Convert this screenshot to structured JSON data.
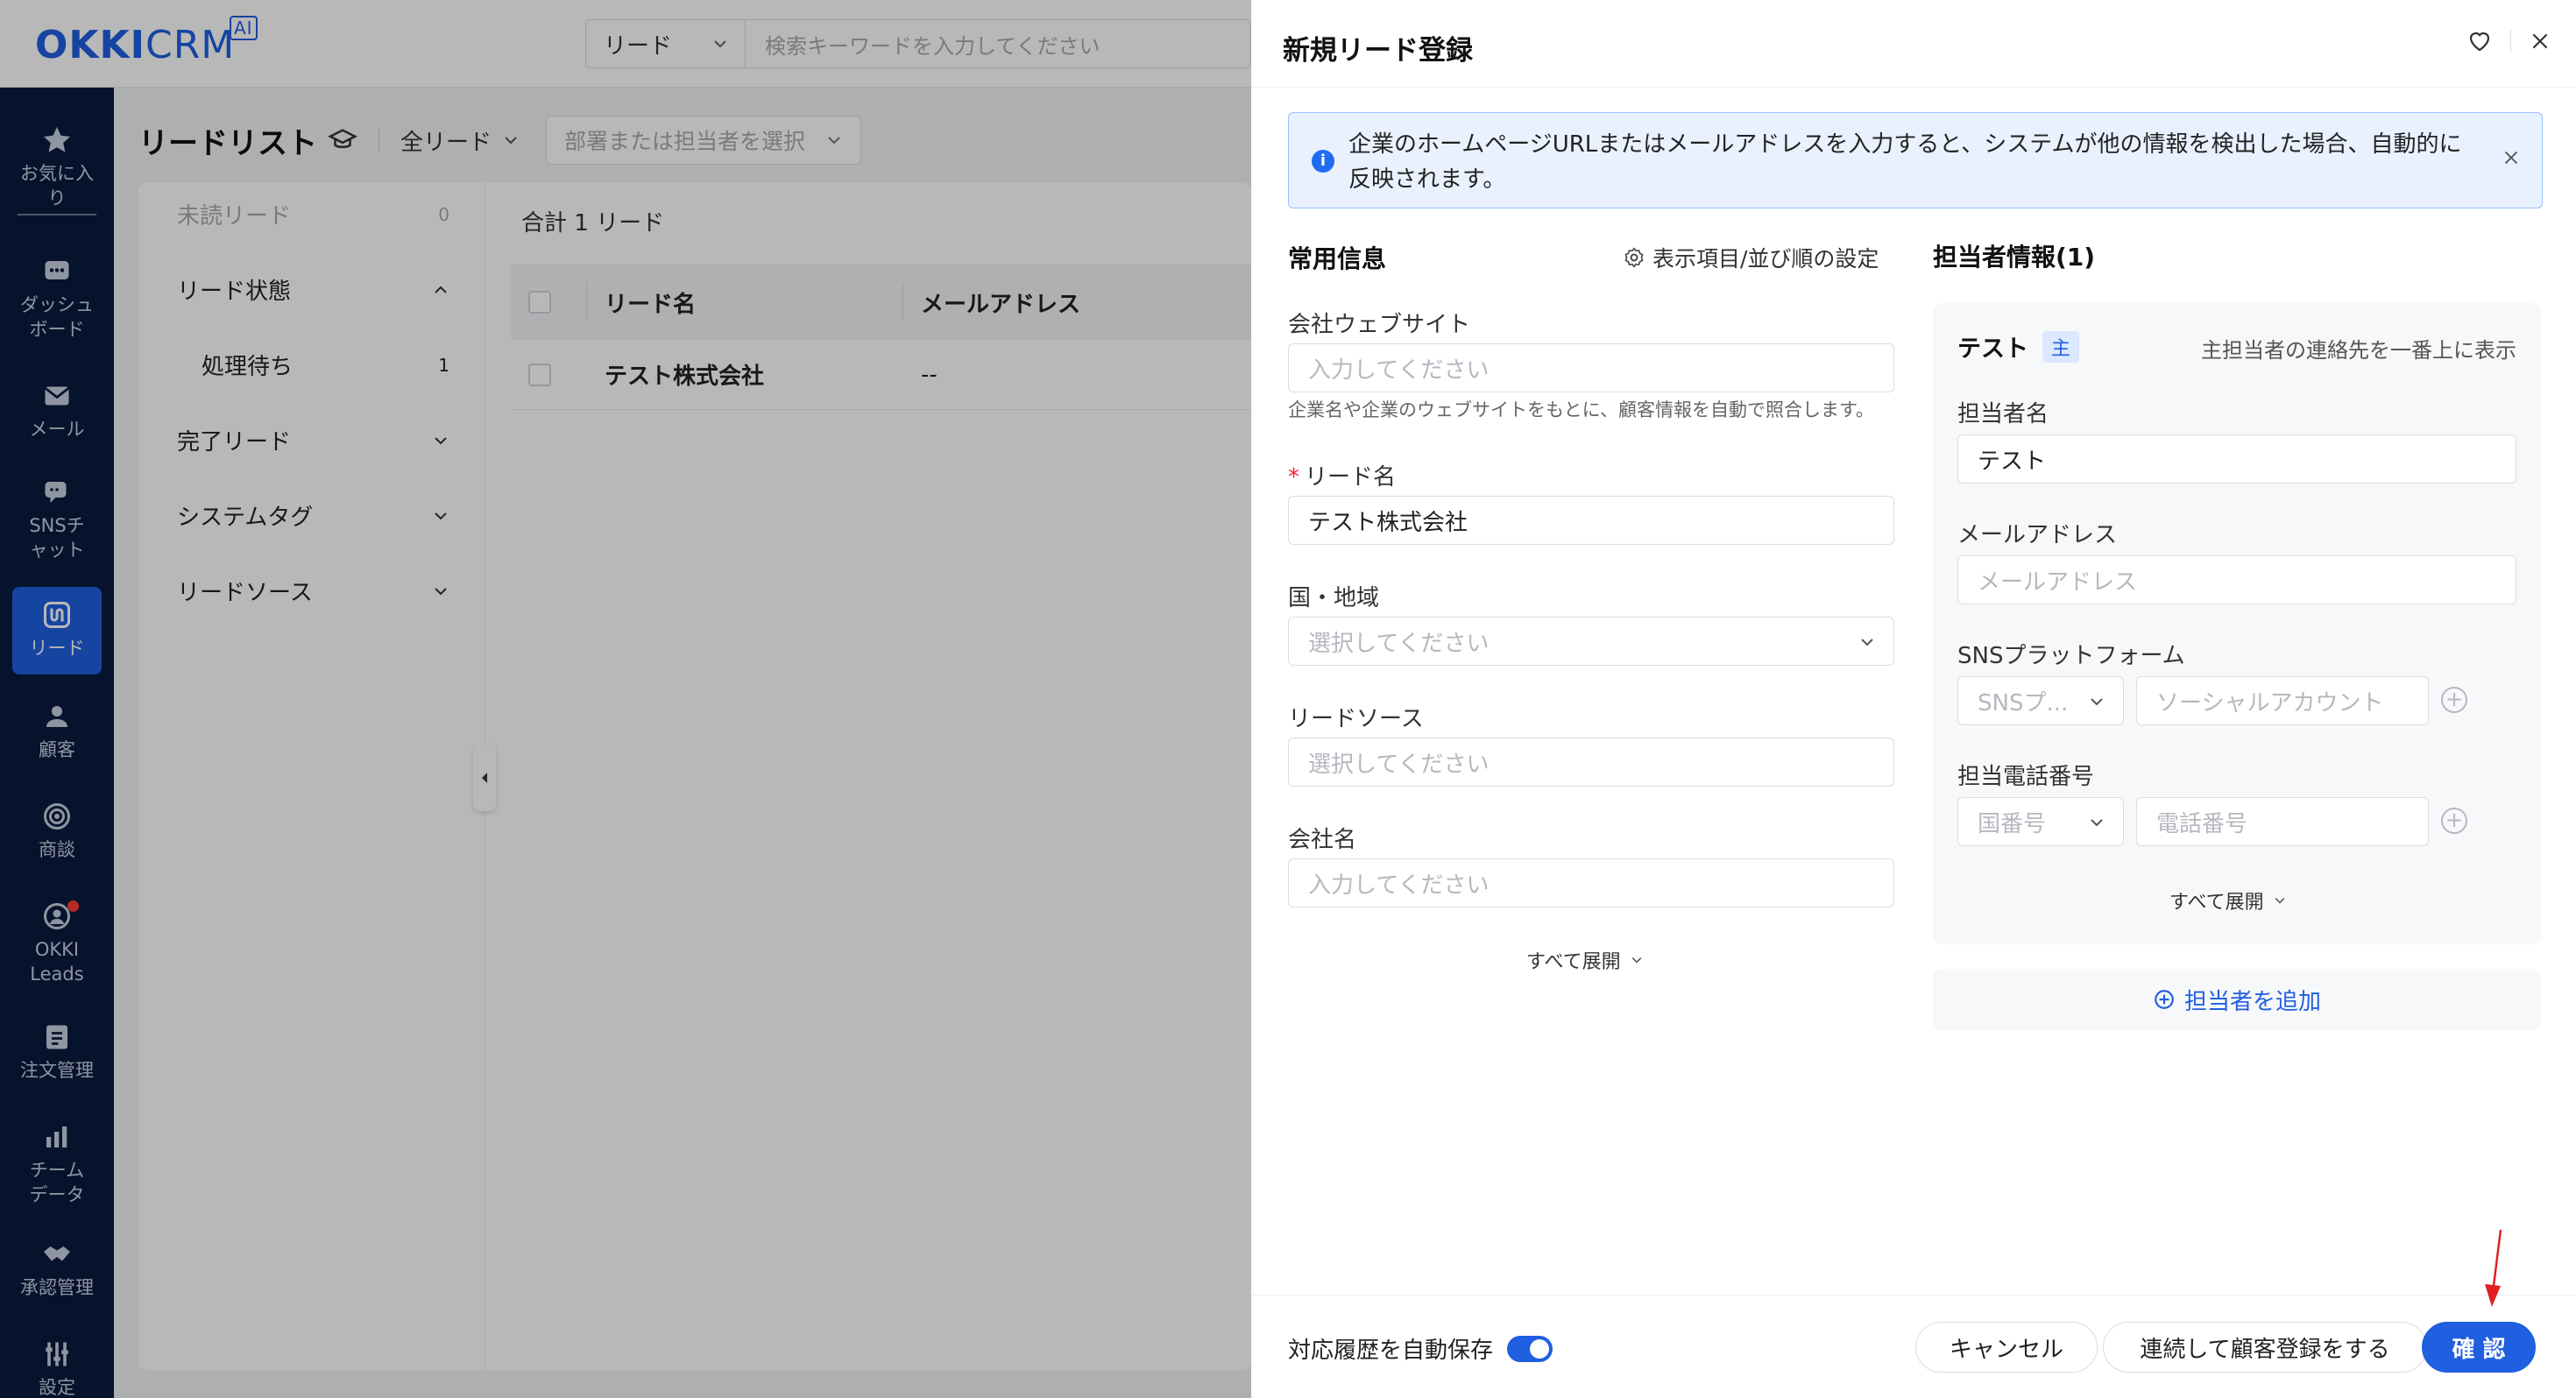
{
  "app": {
    "logo_main": "OKKI",
    "logo_sub": "CRM",
    "logo_ai": "AI"
  },
  "search": {
    "scope": "リード",
    "placeholder": "検索キーワードを入力してください"
  },
  "sidebar": {
    "items": [
      {
        "label": "お気に入り",
        "icon": "star-icon"
      },
      {
        "label": "ダッシュボード",
        "icon": "dashboard-icon"
      },
      {
        "label": "メール",
        "icon": "mail-icon"
      },
      {
        "label": "SNSチャット",
        "icon": "chat-icon"
      },
      {
        "label": "リード",
        "icon": "leads-icon",
        "active": true
      },
      {
        "label": "顧客",
        "icon": "customers-icon"
      },
      {
        "label": "商談",
        "icon": "target-icon"
      },
      {
        "label": "OKKI Leads",
        "icon": "okki-leads-icon"
      },
      {
        "label": "注文管理",
        "icon": "orders-icon"
      },
      {
        "label": "チームデータ",
        "icon": "bar-chart-icon"
      },
      {
        "label": "承認管理",
        "icon": "handshake-icon"
      },
      {
        "label": "設定",
        "icon": "settings-icon"
      }
    ]
  },
  "page": {
    "title": "リードリスト",
    "filter": "全リード",
    "dept_placeholder": "部署または担当者を選択"
  },
  "left_panel": {
    "unread": {
      "label": "未読リード",
      "count": "0"
    },
    "status": {
      "label": "リード状態"
    },
    "pending": {
      "label": "処理待ち",
      "count": "1"
    },
    "done": {
      "label": "完了リード"
    },
    "tags": {
      "label": "システムタグ"
    },
    "source": {
      "label": "リードソース"
    }
  },
  "table": {
    "total": "合計 1 リード",
    "columns": [
      "リード名",
      "メールアドレス"
    ],
    "rows": [
      {
        "name": "テスト株式会社",
        "email": "--"
      }
    ]
  },
  "drawer": {
    "title": "新規リード登録",
    "notice": "企業のホームページURLまたはメールアドレスを入力すると、システムが他の情報を検出した場合、自動的に反映されます。",
    "common": {
      "title": "常用信息",
      "settings_label": "表示項目/並び順の設定",
      "website_label": "会社ウェブサイト",
      "website_placeholder": "入力してください",
      "website_hint": "企業名や企業のウェブサイトをもとに、顧客情報を自動で照合します。",
      "lead_name_label": "リード名",
      "lead_name_value": "テスト株式会社",
      "country_label": "国・地域",
      "country_placeholder": "選択してください",
      "source_label": "リードソース",
      "source_placeholder": "選択してください",
      "company_label": "会社名",
      "company_placeholder": "入力してください",
      "expand": "すべて展開"
    },
    "contacts": {
      "title": "担当者情報(1)",
      "card_name": "テスト",
      "primary_badge": "主",
      "primary_hint": "主担当者の連絡先を一番上に表示",
      "name_label": "担当者名",
      "name_value": "テスト",
      "email_label": "メールアドレス",
      "email_placeholder": "メールアドレス",
      "sns_label": "SNSプラットフォーム",
      "sns_platform_placeholder": "SNSプ...",
      "sns_account_placeholder": "ソーシャルアカウント",
      "phone_label": "担当電話番号",
      "phone_code_placeholder": "国番号",
      "phone_placeholder": "電話番号",
      "expand": "すべて展開",
      "add_label": "担当者を追加"
    },
    "footer": {
      "autosave_label": "対応履歴を自動保存",
      "autosave_on": true,
      "cancel": "キャンセル",
      "continue": "連続して顧客登録をする",
      "confirm": "確 認"
    }
  },
  "colors": {
    "primary": "#1f5fe0",
    "sidebar": "#0b1b3f",
    "annotation_arrow": "#e02020"
  }
}
